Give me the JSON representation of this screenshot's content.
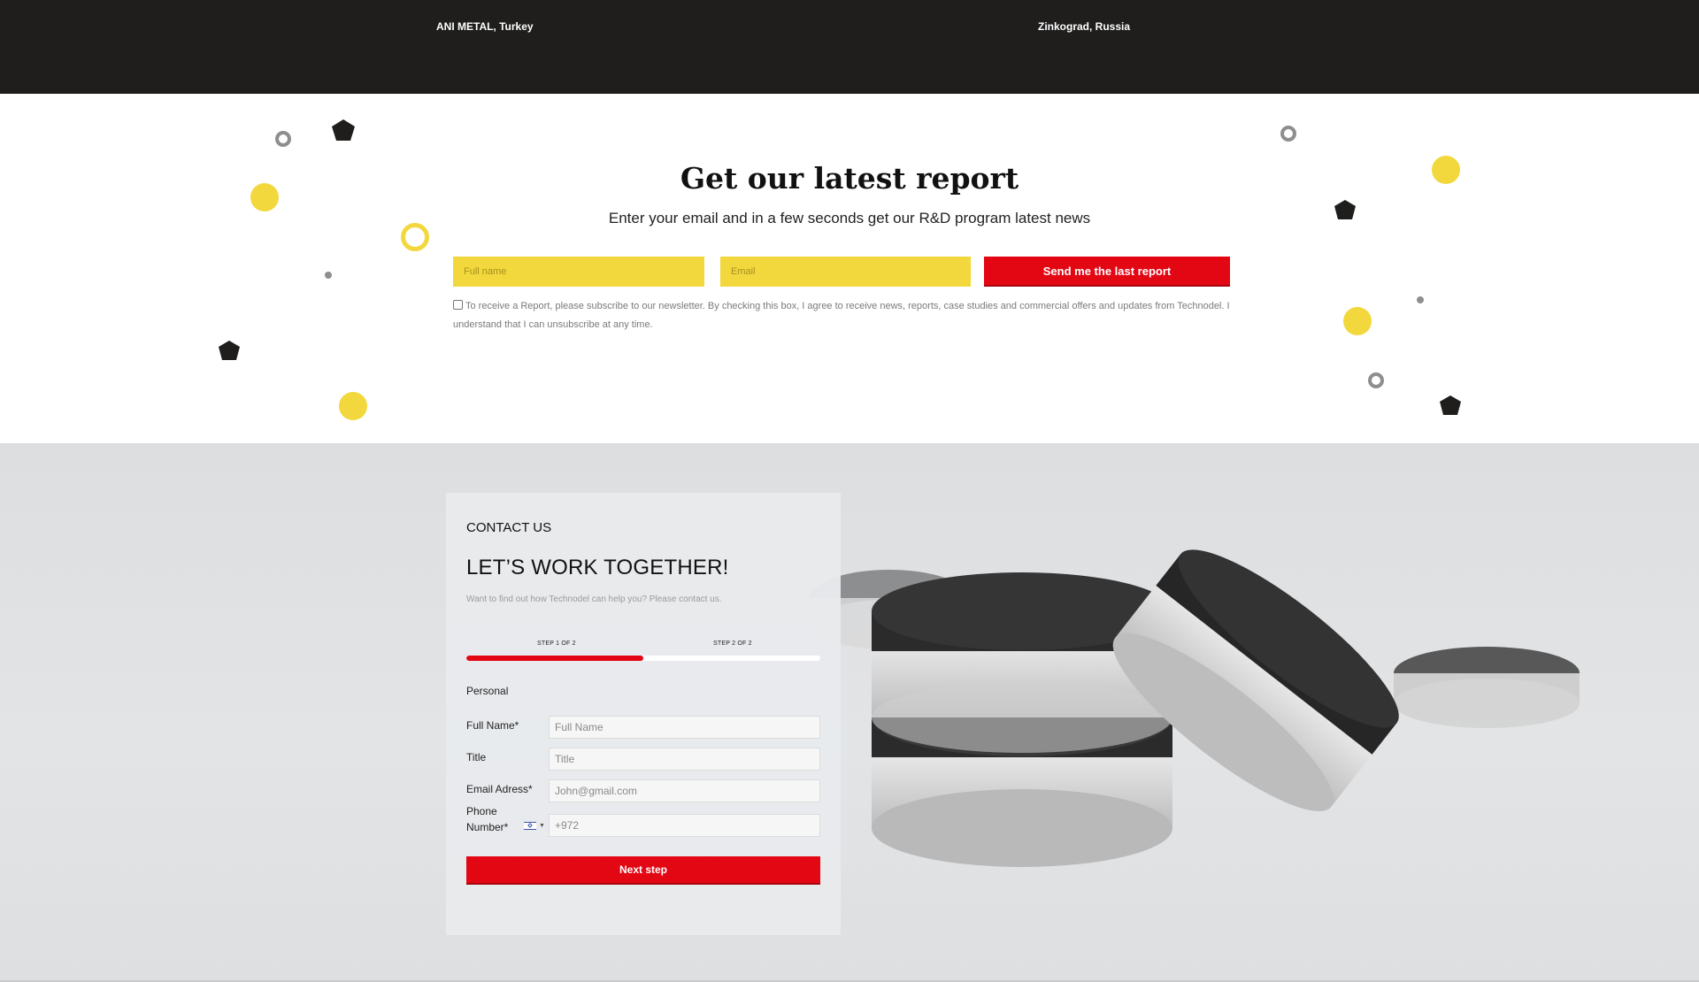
{
  "locations": [
    "ANI METAL, Turkey",
    "Zinkograd, Russia"
  ],
  "report": {
    "title": "Get our latest report",
    "subtitle": "Enter your email and in a few seconds get our R&D program latest news",
    "fullname_placeholder": "Full name",
    "email_placeholder": "Email",
    "send_label": "Send me the last report",
    "consent_text": "To receive a Report, please subscribe to our newsletter. By checking this box, I agree to receive news, reports, case studies and commercial offers and updates from Technodel. I understand that I can unsubscribe at any time."
  },
  "contact": {
    "eyebrow": "CONTACT US",
    "heading": "LET’S WORK TOGETHER!",
    "description": "Want to find out how Technodel can help you? Please contact us.",
    "steps": [
      "STEP 1 OF 2",
      "STEP 2 OF 2"
    ],
    "progress_fraction": 0.5,
    "section_label": "Personal",
    "fields": [
      {
        "label": "Full Name*",
        "placeholder": "Full Name"
      },
      {
        "label": "Title",
        "placeholder": "Title"
      },
      {
        "label": "Email Adress*",
        "placeholder": "John@gmail.com"
      },
      {
        "label": "Phone Number*",
        "placeholder": "+972"
      }
    ],
    "phone_flag": "israel-flag-icon",
    "next_label": "Next step"
  },
  "colors": {
    "brand_red": "#e30613",
    "yellow": "#f2d83c",
    "dark": "#1f1e1d"
  }
}
